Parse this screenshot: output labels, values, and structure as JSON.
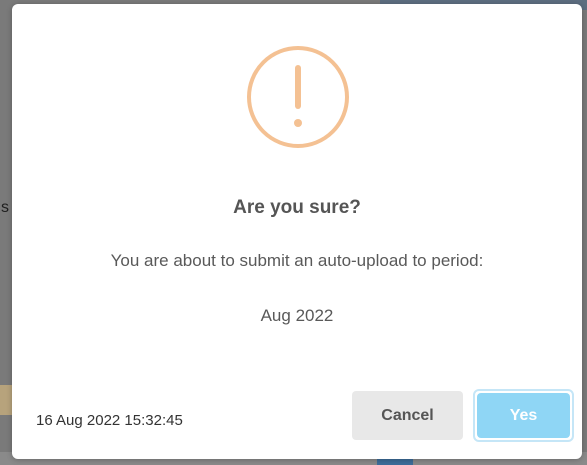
{
  "background": {
    "left_text": "s"
  },
  "dialog": {
    "icon": "exclamation-circle-icon",
    "icon_color": "#f4c193",
    "title": "Are you sure?",
    "message": "You are about to submit an auto-upload to period:",
    "period": "Aug 2022",
    "timestamp": "16 Aug 2022 15:32:45",
    "buttons": {
      "cancel_label": "Cancel",
      "confirm_label": "Yes"
    },
    "confirm_color": "#8fd6f5"
  }
}
